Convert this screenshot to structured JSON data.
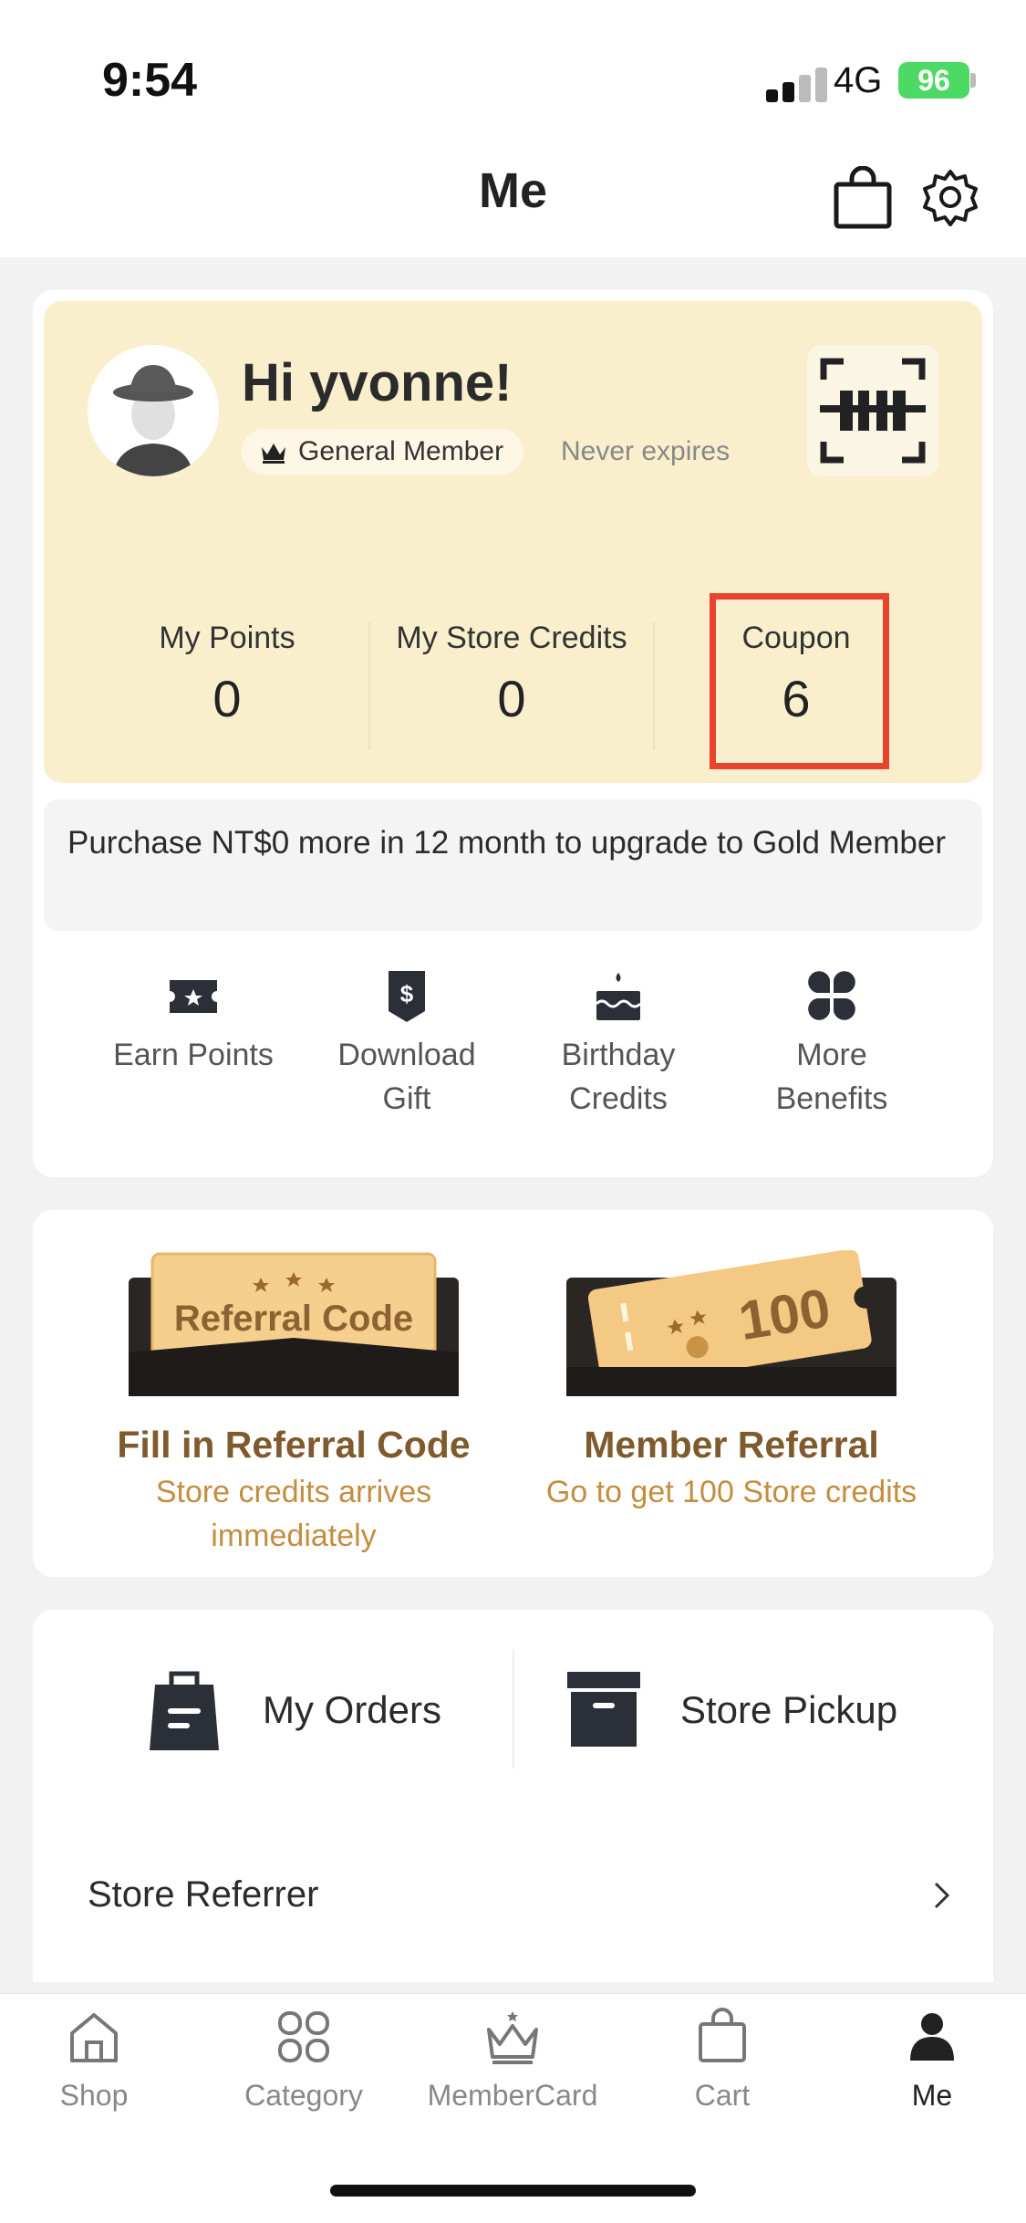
{
  "status_bar": {
    "time": "9:54",
    "network": "4G",
    "battery": "96"
  },
  "header": {
    "title": "Me",
    "bag_icon": "shopping-bag-icon",
    "settings_icon": "gear-icon"
  },
  "profile": {
    "greeting": "Hi yvonne!",
    "tier": "General Member",
    "expiry": "Never expires"
  },
  "stats": [
    {
      "label": "My Points",
      "value": "0"
    },
    {
      "label": "My Store Credits",
      "value": "0"
    },
    {
      "label": "Coupon",
      "value": "6"
    }
  ],
  "upgrade_notice": "Purchase NT$0 more in 12 month to upgrade to Gold Member",
  "benefits": [
    {
      "line1": "Earn Points",
      "line2": ""
    },
    {
      "line1": "Download",
      "line2": "Gift"
    },
    {
      "line1": "Birthday",
      "line2": "Credits"
    },
    {
      "line1": "More",
      "line2": "Benefits"
    }
  ],
  "referral": {
    "fill_image_text": "Referral Code",
    "fill_title": "Fill in Referral Code",
    "fill_sub_line1": "Store credits arrives",
    "fill_sub_line2": "immediately",
    "member_image_text": "100",
    "member_title": "Member Referral",
    "member_sub": "Go to get 100 Store credits"
  },
  "orders": {
    "my_orders": "My Orders",
    "store_pickup": "Store Pickup"
  },
  "store_referrer": "Store Referrer",
  "tabs": [
    {
      "label": "Shop",
      "icon": "home-icon"
    },
    {
      "label": "Category",
      "icon": "category-icon"
    },
    {
      "label": "MemberCard",
      "icon": "crown-icon"
    },
    {
      "label": "Cart",
      "icon": "cart-bag-icon"
    },
    {
      "label": "Me",
      "icon": "person-icon",
      "active": true
    }
  ],
  "colors": {
    "card_bg": "#f9efcd",
    "highlight": "#e8432d",
    "referral_title": "#7f5a2c",
    "referral_sub": "#c48d3f"
  }
}
